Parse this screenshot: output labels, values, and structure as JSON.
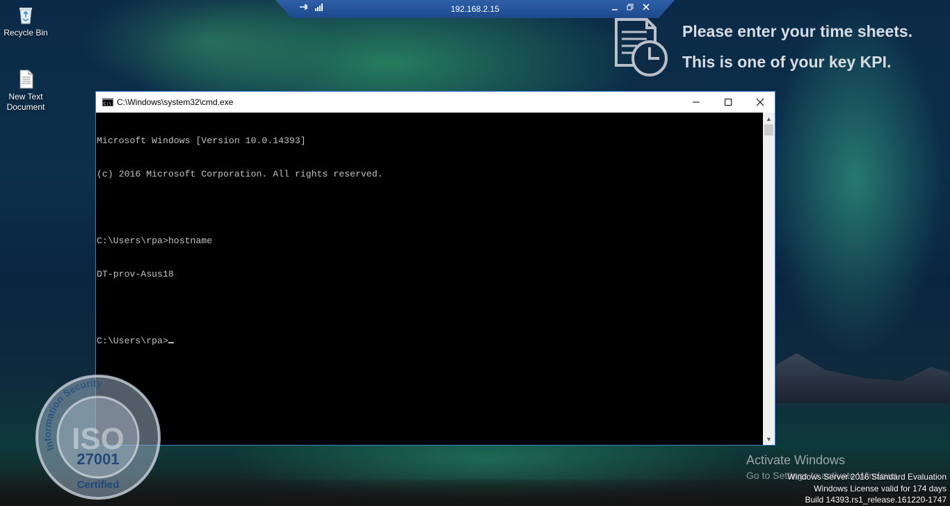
{
  "desktop": {
    "icons": [
      {
        "label": "Recycle Bin",
        "icon": "recycle-bin-icon"
      },
      {
        "label": "New Text\nDocument",
        "icon": "text-document-icon"
      }
    ]
  },
  "rdp_bar": {
    "host": "192.168.2.15",
    "pin_icon": "pin-icon",
    "signal_icon": "signal-strength-icon",
    "minimize_icon": "minimize-icon",
    "restore_icon": "restore-icon",
    "close_icon": "close-icon"
  },
  "kpi_banner": {
    "line1": "Please enter your time sheets.",
    "line2": "This is one of your key KPI."
  },
  "cmd_window": {
    "title": "C:\\Windows\\system32\\cmd.exe",
    "lines": [
      "Microsoft Windows [Version 10.0.14393]",
      "(c) 2016 Microsoft Corporation. All rights reserved.",
      "",
      "C:\\Users\\rpa>hostname",
      "DT-prov-Asus18",
      ""
    ],
    "prompt": "C:\\Users\\rpa>"
  },
  "iso_seal": {
    "top_text": "Information Security",
    "standard": "27001",
    "bottom_text": "Certified"
  },
  "watermark": {
    "activate_title": "Activate Windows",
    "activate_sub": "Go to Settings to activate Windows.",
    "edition": "Windows Server 2016 Standard Evaluation",
    "license": "Windows License valid for 174 days",
    "build": "Build 14393.rs1_release.161220-1747"
  },
  "colors": {
    "console_bg": "#000000",
    "console_fg": "#c0c0c0",
    "window_border": "#3c7fd4",
    "rdp_bar": "#2d5fa8"
  }
}
